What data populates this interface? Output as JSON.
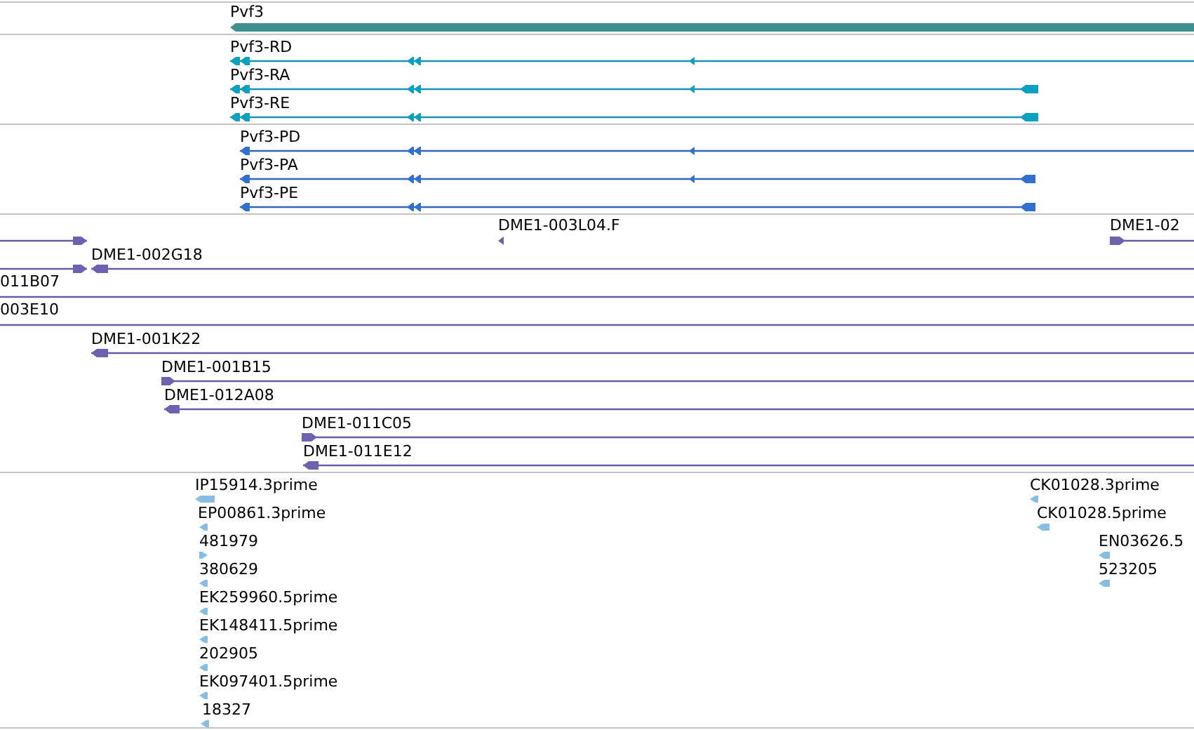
{
  "tracks": [
    {
      "kind": "gene",
      "features": [
        {
          "label": "Pvf3",
          "reverse": true
        }
      ]
    },
    {
      "kind": "transcript",
      "features": [
        {
          "label": "Pvf3-RD",
          "reverse": true
        },
        {
          "label": "Pvf3-RA",
          "reverse": true
        },
        {
          "label": "Pvf3-RE",
          "reverse": true
        }
      ]
    },
    {
      "kind": "protein",
      "features": [
        {
          "label": "Pvf3-PD",
          "reverse": true
        },
        {
          "label": "Pvf3-PA",
          "reverse": true
        },
        {
          "label": "Pvf3-PE",
          "reverse": true
        }
      ]
    },
    {
      "kind": "clone",
      "features": [
        {
          "reverse": false
        },
        {
          "label": "DME1-003L04.F",
          "reverse": true
        },
        {
          "label": "DME1-02",
          "reverse": false
        },
        {
          "reverse": false
        },
        {
          "label": "DME1-002G18",
          "reverse": true
        },
        {
          "label": "011B07"
        },
        {
          "label": "003E10"
        },
        {
          "label": "DME1-001K22",
          "reverse": true
        },
        {
          "label": "DME1-001B15",
          "reverse": false
        },
        {
          "label": "DME1-012A08",
          "reverse": true
        },
        {
          "label": "DME1-011C05",
          "reverse": false
        },
        {
          "label": "DME1-011E12",
          "reverse": true
        }
      ]
    },
    {
      "kind": "est",
      "features": [
        {
          "label": "IP15914.3prime",
          "reverse": true
        },
        {
          "label": "EP00861.3prime",
          "reverse": true
        },
        {
          "label": "481979",
          "reverse": false
        },
        {
          "label": "380629",
          "reverse": true
        },
        {
          "label": "EK259960.5prime",
          "reverse": true
        },
        {
          "label": "EK148411.5prime",
          "reverse": true
        },
        {
          "label": "202905",
          "reverse": true
        },
        {
          "label": "EK097401.5prime",
          "reverse": true
        },
        {
          "label": "18327",
          "reverse": true
        },
        {
          "label": "CK01028.3prime",
          "reverse": true
        },
        {
          "label": "CK01028.5prime",
          "reverse": true
        },
        {
          "label": "EN03626.5",
          "reverse": true
        },
        {
          "label": "523205",
          "reverse": true
        }
      ]
    }
  ]
}
